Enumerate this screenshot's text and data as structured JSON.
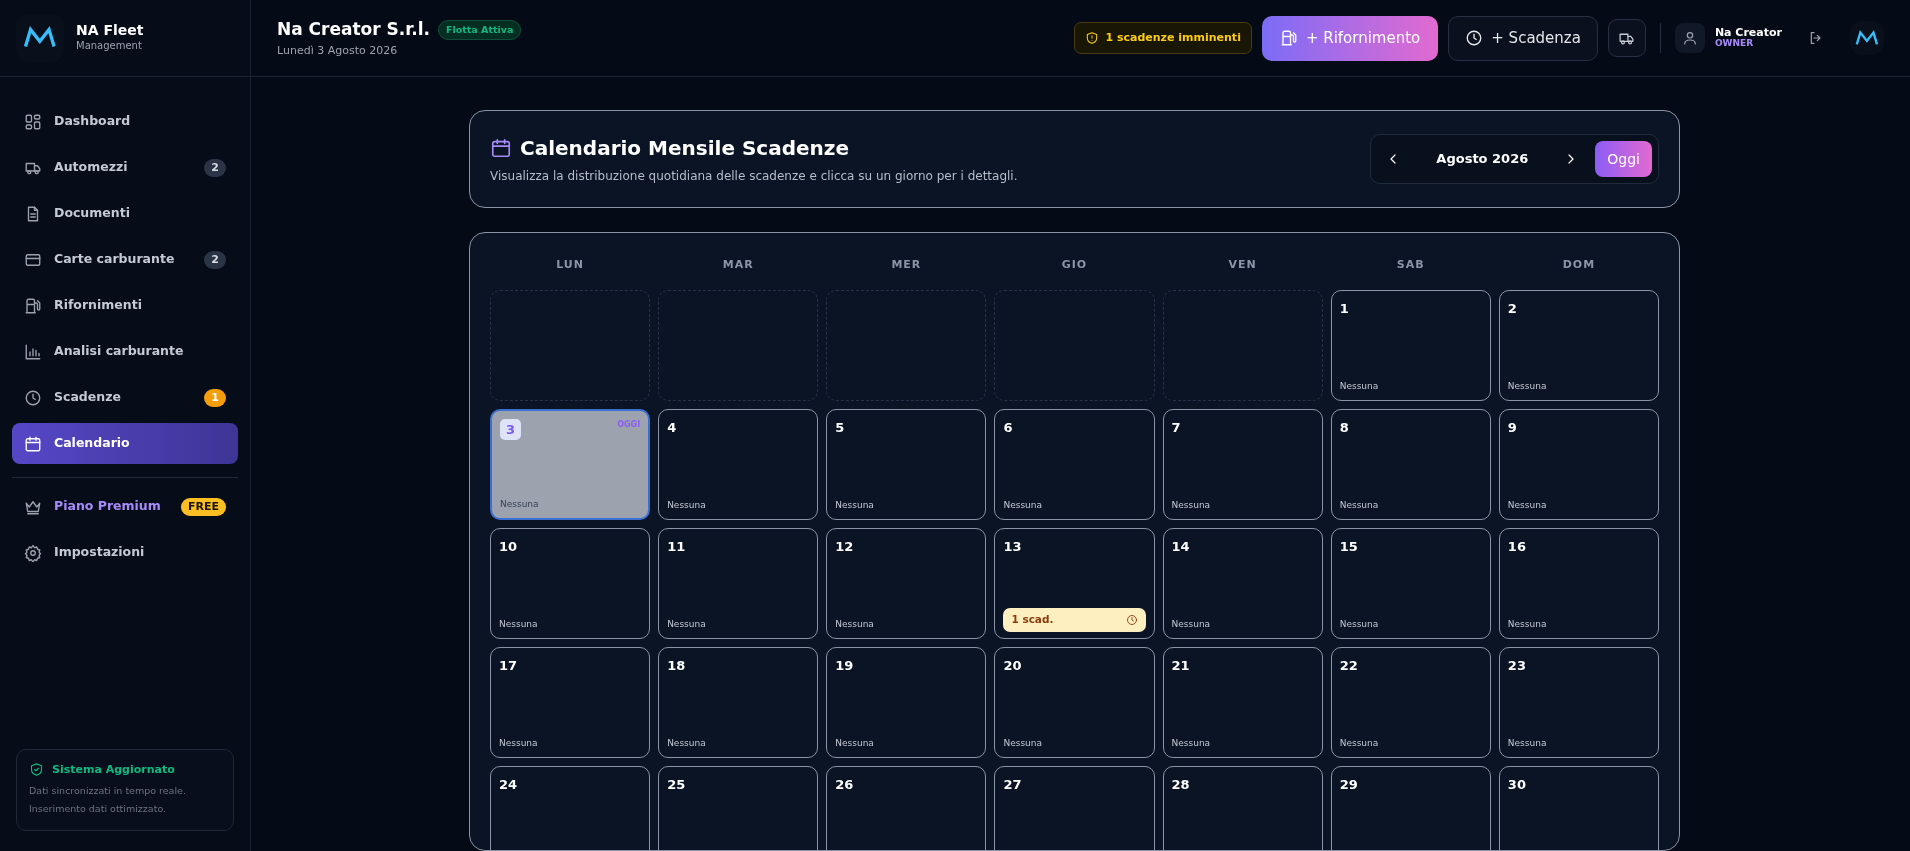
{
  "sidebar": {
    "logo": {
      "title": "NA Fleet",
      "subtitle": "Management"
    },
    "items": [
      {
        "label": "Dashboard",
        "selected": false
      },
      {
        "label": "Automezzi",
        "badge": "2",
        "kind": "count",
        "selected": false
      },
      {
        "label": "Documenti",
        "selected": false
      },
      {
        "label": "Carte carburante",
        "badge": "2",
        "kind": "count",
        "selected": false
      },
      {
        "label": "Rifornimenti",
        "selected": false
      },
      {
        "label": "Analisi carburante",
        "selected": false
      },
      {
        "label": "Scadenze",
        "badge": "1",
        "kind": "alert",
        "selected": false
      },
      {
        "label": "Calendario",
        "selected": true
      }
    ],
    "extra_items": [
      {
        "label": "Piano Premium",
        "badge": "FREE",
        "kind": "premium"
      },
      {
        "label": "Impostazioni",
        "kind": "plain"
      }
    ],
    "status": {
      "title": "Sistema Aggiornato",
      "lines": [
        "Dati sincronizzati in tempo reale.",
        "Inserimento dati ottimizzato."
      ]
    }
  },
  "header": {
    "company": "Na Creator S.r.l.",
    "status_badge": "Flotta Attiva",
    "date": "Lunedì 3 Agosto 2026",
    "alert": "1 scadenze imminenti",
    "primary_button": "+ Rifornimento",
    "secondary_button": "+ Scadenza",
    "user": {
      "name": "Na Creator",
      "role": "OWNER"
    }
  },
  "calendar": {
    "title": "Calendario Mensile Scadenze",
    "subtitle": "Visualizza la distribuzione quotidiana delle scadenze e clicca su un giorno per i dettagli.",
    "month": "Agosto 2026",
    "today_button": "Oggi",
    "weekdays": [
      "LUN",
      "MAR",
      "MER",
      "GIO",
      "VEN",
      "SAB",
      "DOM"
    ],
    "days": [
      {
        "kind": "empty"
      },
      {
        "kind": "empty"
      },
      {
        "kind": "empty"
      },
      {
        "kind": "empty"
      },
      {
        "kind": "empty"
      },
      {
        "kind": "day",
        "number": "1",
        "note": "Nessuna",
        "today": false
      },
      {
        "kind": "day",
        "number": "2",
        "note": "Nessuna",
        "today": false
      },
      {
        "kind": "day",
        "number": "3",
        "note": "Nessuna",
        "today": true,
        "today_label": "OGGI"
      },
      {
        "kind": "day",
        "number": "4",
        "note": "Nessuna",
        "today": false
      },
      {
        "kind": "day",
        "number": "5",
        "note": "Nessuna",
        "today": false
      },
      {
        "kind": "day",
        "number": "6",
        "note": "Nessuna",
        "today": false
      },
      {
        "kind": "day",
        "number": "7",
        "note": "Nessuna",
        "today": false
      },
      {
        "kind": "day",
        "number": "8",
        "note": "Nessuna",
        "today": false
      },
      {
        "kind": "day",
        "number": "9",
        "note": "Nessuna",
        "today": false
      },
      {
        "kind": "day",
        "number": "10",
        "note": "Nessuna",
        "today": false
      },
      {
        "kind": "day",
        "number": "11",
        "note": "Nessuna",
        "today": false
      },
      {
        "kind": "day",
        "number": "12",
        "note": "Nessuna",
        "today": false
      },
      {
        "kind": "day",
        "number": "13",
        "deadline": "1 scad.",
        "today": false
      },
      {
        "kind": "day",
        "number": "14",
        "note": "Nessuna",
        "today": false
      },
      {
        "kind": "day",
        "number": "15",
        "note": "Nessuna",
        "today": false
      },
      {
        "kind": "day",
        "number": "16",
        "note": "Nessuna",
        "today": false
      },
      {
        "kind": "day",
        "number": "17",
        "note": "Nessuna",
        "today": false
      },
      {
        "kind": "day",
        "number": "18",
        "note": "Nessuna",
        "today": false
      },
      {
        "kind": "day",
        "number": "19",
        "note": "Nessuna",
        "today": false
      },
      {
        "kind": "day",
        "number": "20",
        "note": "Nessuna",
        "today": false
      },
      {
        "kind": "day",
        "number": "21",
        "note": "Nessuna",
        "today": false
      },
      {
        "kind": "day",
        "number": "22",
        "note": "Nessuna",
        "today": false
      },
      {
        "kind": "day",
        "number": "23",
        "note": "Nessuna",
        "today": false
      },
      {
        "kind": "day",
        "number": "24",
        "today": false
      },
      {
        "kind": "day",
        "number": "25",
        "today": false
      },
      {
        "kind": "day",
        "number": "26",
        "today": false
      },
      {
        "kind": "day",
        "number": "27",
        "today": false
      },
      {
        "kind": "day",
        "number": "28",
        "today": false
      },
      {
        "kind": "day",
        "number": "29",
        "today": false
      },
      {
        "kind": "day",
        "number": "30",
        "today": false
      }
    ]
  }
}
